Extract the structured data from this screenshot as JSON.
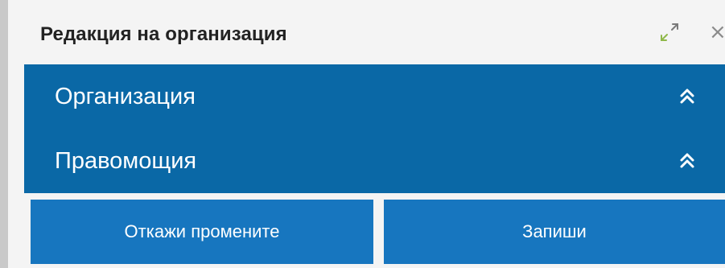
{
  "dialog": {
    "title": "Редакция на организация",
    "close_glyph": "×",
    "icons": {
      "maximize": "maximize-icon",
      "close": "close-icon",
      "collapse": "double-chevron-up-icon"
    }
  },
  "sections": [
    {
      "label": "Организация"
    },
    {
      "label": "Правомощия"
    }
  ],
  "buttons": {
    "cancel_label": "Откажи промените",
    "save_label": "Запиши"
  },
  "colors": {
    "section_bg": "#0a68a6",
    "button_bg": "#1776bf",
    "dialog_bg": "#f4f4f4"
  }
}
